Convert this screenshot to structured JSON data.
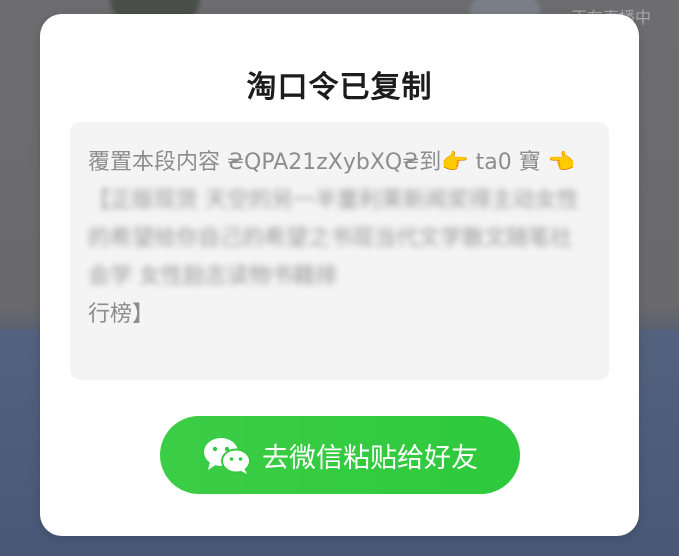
{
  "background": {
    "status_text": "正在直播中"
  },
  "modal": {
    "title": "淘口令已复制",
    "copied_text": {
      "prefix": "覆置本段内容 ₴QPA21zXybXQ₴到",
      "point_right_emoji": "👉",
      "middle": " ta0 寶",
      "point_left_emoji": "👈",
      "blurred_part": "【正版现货 天空的另一半童利莱新闻奖得主动女性的希望给你自己的希望之书现当代文学散文随笔社会学 女性励志读物书籍排",
      "tail": "行榜】"
    },
    "button": {
      "label": "去微信粘贴给好友",
      "icon": "wechat-icon"
    }
  },
  "colors": {
    "button_green": "#36c940",
    "text_box_bg": "#f4f4f5",
    "text_gray": "#8d8d8d"
  }
}
